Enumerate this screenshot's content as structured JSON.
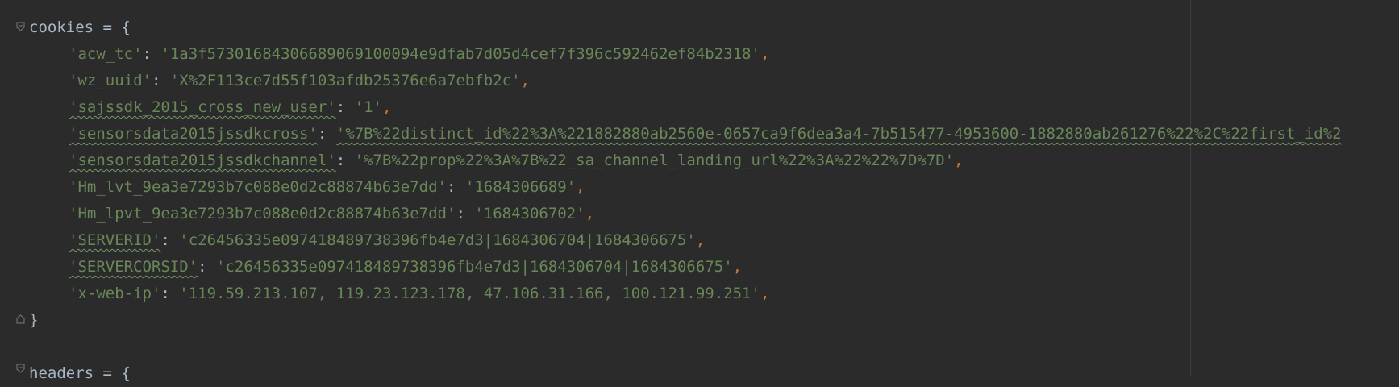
{
  "editor": {
    "colors": {
      "background": "#2b2b2b",
      "text": "#a9b7c6",
      "string": "#6a8759",
      "comma": "#cc7832",
      "guide": "#3c3c3c"
    },
    "cookies_header": "cookies = {",
    "cookies": [
      {
        "key": "'acw_tc'",
        "value": "'1a3f57301684306689069100094e9dfab7d05d4cef7f396c592462ef84b2318'"
      },
      {
        "key": "'wz_uuid'",
        "value": "'X%2F113ce7d55f103afdb25376e6a7ebfb2c'"
      },
      {
        "key": "'sajssdk_2015_cross_new_user'",
        "value": "'1'"
      },
      {
        "key": "'sensorsdata2015jssdkcross'",
        "value": "'%7B%22distinct_id%22%3A%221882880ab2560e-0657ca9f6dea3a4-7b515477-4953600-1882880ab261276%22%2C%22first_id%2"
      },
      {
        "key": "'sensorsdata2015jssdkchannel'",
        "value": "'%7B%22prop%22%3A%7B%22_sa_channel_landing_url%22%3A%22%22%7D%7D'"
      },
      {
        "key": "'Hm_lvt_9ea3e7293b7c088e0d2c88874b63e7dd'",
        "value": "'1684306689'"
      },
      {
        "key": "'Hm_lpvt_9ea3e7293b7c088e0d2c88874b63e7dd'",
        "value": "'1684306702'"
      },
      {
        "key": "'SERVERID'",
        "value": "'c26456335e097418489738396fb4e7d3|1684306704|1684306675'"
      },
      {
        "key": "'SERVERCORSID'",
        "value": "'c26456335e097418489738396fb4e7d3|1684306704|1684306675'"
      },
      {
        "key": "'x-web-ip'",
        "value": "'119.59.213.107, 119.23.123.178, 47.106.31.166, 100.121.99.251'"
      }
    ],
    "separator": ": ",
    "comma": ",",
    "cookies_close": "}",
    "headers_header": "headers = {"
  }
}
